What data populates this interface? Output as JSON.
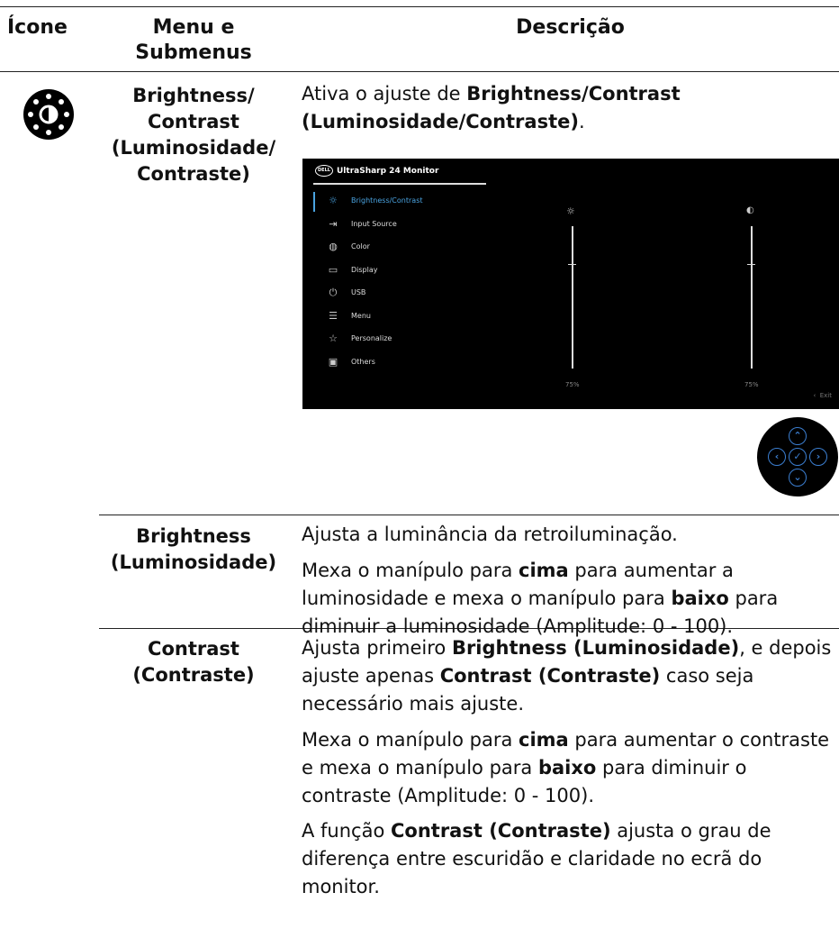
{
  "header": {
    "icon_col": "Ícone",
    "menu_col_1": "Menu e",
    "menu_col_2": "Submenus",
    "desc_col": "Descrição"
  },
  "row_main": {
    "icon": "brightness-contrast-icon",
    "name_lines": [
      "Brightness/",
      "Contrast",
      "(Luminosidade/",
      "Contraste)"
    ],
    "desc_prefix": "Ativa o ajuste de ",
    "desc_bold": "Brightness/Contrast (Luminosidade/Contraste)",
    "desc_suffix": "."
  },
  "osd": {
    "title": "UltraSharp 24 Monitor",
    "logo": "DELL",
    "menu": [
      {
        "label": "Brightness/Contrast",
        "icon": "sun-icon",
        "active": true
      },
      {
        "label": "Input Source",
        "icon": "input-icon",
        "active": false
      },
      {
        "label": "Color",
        "icon": "palette-icon",
        "active": false
      },
      {
        "label": "Display",
        "icon": "display-icon",
        "active": false
      },
      {
        "label": "USB",
        "icon": "usb-icon",
        "active": false
      },
      {
        "label": "Menu",
        "icon": "menu-icon",
        "active": false
      },
      {
        "label": "Personalize",
        "icon": "star-icon",
        "active": false
      },
      {
        "label": "Others",
        "icon": "others-icon",
        "active": false
      }
    ],
    "brightness_value": "75%",
    "contrast_value": "75%",
    "exit_label": "Exit"
  },
  "rows": [
    {
      "name_lines": [
        "Brightness",
        "(Luminosidade)"
      ],
      "paragraphs": [
        [
          {
            "t": "Ajusta a luminância da retroiluminação."
          }
        ],
        [
          {
            "t": "Mexa o manípulo para "
          },
          {
            "t": "cima",
            "b": true
          },
          {
            "t": " para aumentar a luminosidade e mexa o manípulo para "
          },
          {
            "t": "baixo",
            "b": true
          },
          {
            "t": " para diminuir a luminosidade (Amplitude: 0 - 100)."
          }
        ]
      ]
    },
    {
      "name_lines": [
        "Contrast",
        "(Contraste)"
      ],
      "paragraphs": [
        [
          {
            "t": "Ajusta primeiro "
          },
          {
            "t": "Brightness (Luminosidade)",
            "b": true
          },
          {
            "t": ", e depois ajuste apenas "
          },
          {
            "t": "Contrast (Contraste)",
            "b": true
          },
          {
            "t": " caso seja necessário mais ajuste."
          }
        ],
        [
          {
            "t": "Mexa o manípulo para "
          },
          {
            "t": "cima",
            "b": true
          },
          {
            "t": " para aumentar o contraste e mexa o manípulo para "
          },
          {
            "t": "baixo",
            "b": true
          },
          {
            "t": " para diminuir o contraste (Amplitude: 0 - 100)."
          }
        ],
        [
          {
            "t": "A função "
          },
          {
            "t": "Contrast (Contraste)",
            "b": true
          },
          {
            "t": " ajusta o grau de diferença entre escuridão e claridade no ecrã do monitor."
          }
        ]
      ]
    }
  ]
}
